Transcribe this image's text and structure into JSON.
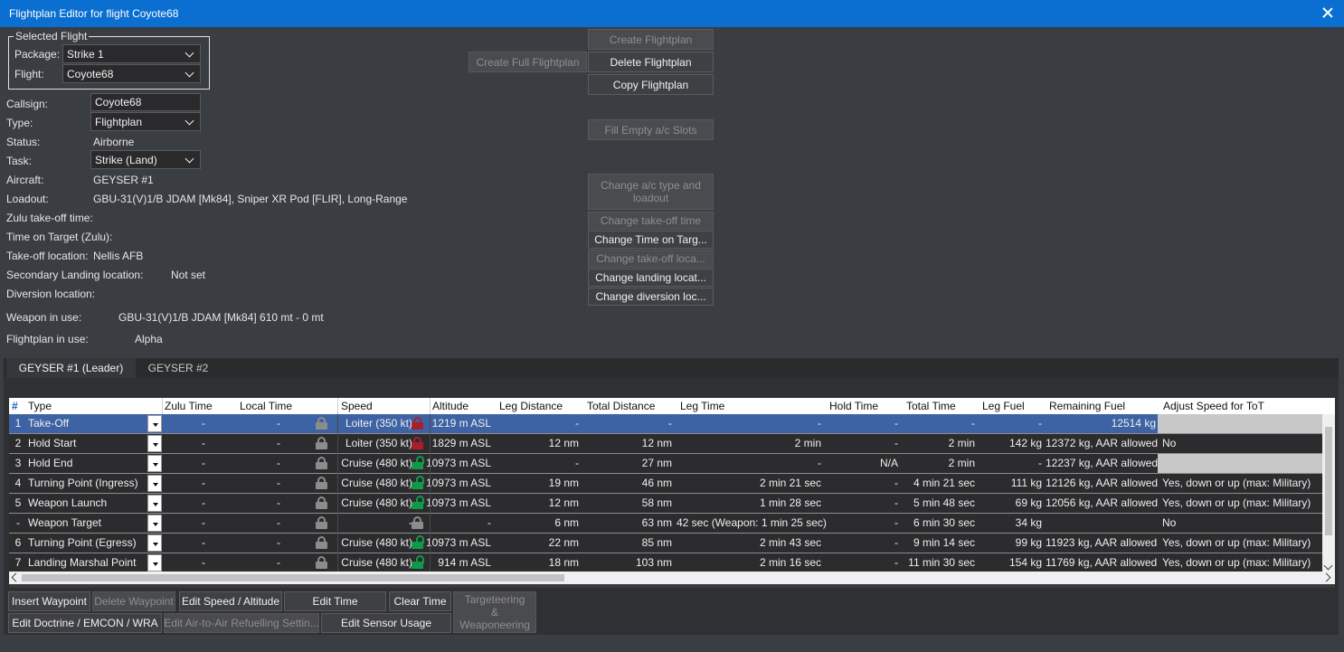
{
  "window": {
    "title": "Flightplan Editor for flight Coyote68"
  },
  "selected_flight": {
    "legend": "Selected Flight",
    "package_label": "Package:",
    "package_value": "Strike 1",
    "flight_label": "Flight:",
    "flight_value": "Coyote68"
  },
  "details": {
    "callsign_label": "Callsign:",
    "callsign_value": "Coyote68",
    "type_label": "Type:",
    "type_value": "Flightplan",
    "status_label": "Status:",
    "status_value": "Airborne",
    "task_label": "Task:",
    "task_value": "Strike (Land)",
    "aircraft_label": "Aircraft:",
    "aircraft_value": "GEYSER #1",
    "loadout_label": "Loadout:",
    "loadout_value": "GBU-31(V)1/B JDAM [Mk84], Sniper XR Pod [FLIR], Long-Range",
    "zulu_takeoff_label": "Zulu take-off time:",
    "tot_label": "Time on Target (Zulu):",
    "takeoff_loc_label": "Take-off location:",
    "takeoff_loc_value": "Nellis AFB",
    "secondary_landing_label": "Secondary Landing location:",
    "secondary_landing_value": "Not set",
    "diversion_label": "Diversion location:",
    "weapon_label": "Weapon in use:",
    "weapon_value": "GBU-31(V)1/B JDAM [Mk84] 610 mt - 0 mt",
    "flightplan_label": "Flightplan in use:",
    "flightplan_value": "Alpha"
  },
  "buttons": {
    "create_flightplan": "Create Flightplan",
    "create_full_flightplan": "Create Full Flightplan",
    "delete_flightplan": "Delete Flightplan",
    "copy_flightplan": "Copy Flightplan",
    "fill_empty": "Fill Empty a/c Slots",
    "change_ac_type": "Change a/c type and loadout",
    "change_takeoff_time": "Change take-off time",
    "change_tot": "Change Time on Targ...",
    "change_takeoff_loc": "Change take-off loca...",
    "change_landing_loc": "Change landing locat...",
    "change_diversion_loc": "Change diversion loc..."
  },
  "tabs": [
    {
      "label": "GEYSER #1 (Leader)"
    },
    {
      "label": "GEYSER #2"
    }
  ],
  "grid": {
    "headers": {
      "num": "#",
      "type": "Type",
      "zulu": "Zulu Time",
      "local": "Local Time",
      "speed": "Speed",
      "altitude": "Altitude",
      "leg_distance": "Leg Distance",
      "total_distance": "Total Distance",
      "leg_time": "Leg Time",
      "hold_time": "Hold Time",
      "total_time": "Total Time",
      "leg_fuel": "Leg Fuel",
      "remaining_fuel": "Remaining Fuel",
      "adjust_speed": "Adjust Speed for ToT"
    },
    "rows": [
      {
        "num": "1",
        "type": "Take-Off",
        "zulu": "-",
        "local": "-",
        "speed": "Loiter (350 kt)",
        "speed_lock": "red",
        "altitude": "1219 m ASL",
        "leg_distance": "-",
        "total_distance": "-",
        "leg_time": "-",
        "hold_time": "-",
        "total_time": "-",
        "leg_fuel": "-",
        "remaining_fuel": "12514 kg",
        "adjust": ""
      },
      {
        "num": "2",
        "type": "Hold Start",
        "zulu": "-",
        "local": "-",
        "speed": "Loiter (350 kt)",
        "speed_lock": "red",
        "altitude": "1829 m ASL",
        "leg_distance": "12 nm",
        "total_distance": "12 nm",
        "leg_time": "2 min",
        "hold_time": "-",
        "total_time": "2 min",
        "leg_fuel": "142 kg",
        "remaining_fuel": "12372 kg, AAR allowed",
        "adjust": "No"
      },
      {
        "num": "3",
        "type": "Hold End",
        "zulu": "-",
        "local": "-",
        "speed": "Cruise (480 kt)",
        "speed_lock": "green",
        "altitude": "10973 m ASL",
        "leg_distance": "-",
        "total_distance": "27 nm",
        "leg_time": "-",
        "hold_time": "N/A",
        "total_time": "2 min",
        "leg_fuel": "-",
        "remaining_fuel": "12237 kg, AAR allowed",
        "adjust": ""
      },
      {
        "num": "4",
        "type": "Turning Point (Ingress)",
        "zulu": "-",
        "local": "-",
        "speed": "Cruise (480 kt)",
        "speed_lock": "green",
        "altitude": "10973 m ASL",
        "leg_distance": "19 nm",
        "total_distance": "46 nm",
        "leg_time": "2 min 21 sec",
        "hold_time": "-",
        "total_time": "4 min 21 sec",
        "leg_fuel": "111 kg",
        "remaining_fuel": "12126 kg, AAR allowed",
        "adjust": "Yes, down or up (max: Military)"
      },
      {
        "num": "5",
        "type": "Weapon Launch",
        "zulu": "-",
        "local": "-",
        "speed": "Cruise (480 kt)",
        "speed_lock": "green",
        "altitude": "10973 m ASL",
        "leg_distance": "12 nm",
        "total_distance": "58 nm",
        "leg_time": "1 min 28 sec",
        "hold_time": "-",
        "total_time": "5 min 48 sec",
        "leg_fuel": "69 kg",
        "remaining_fuel": "12056 kg, AAR allowed",
        "adjust": "Yes, down or up (max: Military)"
      },
      {
        "num": "-",
        "type": "Weapon Target",
        "zulu": "-",
        "local": "-",
        "speed": "-",
        "speed_lock": "gray",
        "altitude": "-",
        "leg_distance": "6 nm",
        "total_distance": "63 nm",
        "leg_time": "42 sec (Weapon: 1 min 25 sec)",
        "hold_time": "-",
        "total_time": "6 min 30 sec",
        "leg_fuel": "34 kg",
        "remaining_fuel": "",
        "adjust": "No"
      },
      {
        "num": "6",
        "type": "Turning Point (Egress)",
        "zulu": "-",
        "local": "-",
        "speed": "Cruise (480 kt)",
        "speed_lock": "green",
        "altitude": "10973 m ASL",
        "leg_distance": "22 nm",
        "total_distance": "85 nm",
        "leg_time": "2 min 43 sec",
        "hold_time": "-",
        "total_time": "9 min 14 sec",
        "leg_fuel": "99 kg",
        "remaining_fuel": "11923 kg, AAR allowed",
        "adjust": "Yes, down or up (max: Military)"
      },
      {
        "num": "7",
        "type": "Landing Marshal Point",
        "zulu": "-",
        "local": "-",
        "speed": "Cruise (480 kt)",
        "speed_lock": "green",
        "altitude": "914 m ASL",
        "leg_distance": "18 nm",
        "total_distance": "103 nm",
        "leg_time": "2 min 16 sec",
        "hold_time": "-",
        "total_time": "11 min 30 sec",
        "leg_fuel": "154 kg",
        "remaining_fuel": "11769 kg, AAR allowed",
        "adjust": "Yes, down or up (max: Military)"
      }
    ]
  },
  "bottom_buttons": {
    "insert_waypoint": "Insert Waypoint",
    "delete_waypoint": "Delete Waypoint",
    "edit_speed_alt": "Edit Speed / Altitude",
    "edit_time": "Edit Time",
    "clear_time": "Clear Time",
    "targeteering": "Targeteering & Weaponeering",
    "edit_doctrine": "Edit Doctrine / EMCON / WRA",
    "edit_aar": "Edit Air-to-Air Refuelling Settin...",
    "edit_sensor": "Edit Sensor Usage"
  },
  "colors": {
    "titlebar": "#0a6fd0",
    "selected_row": "#3e63a4",
    "lock_red": "#a8202c",
    "lock_green": "#0f9a4a"
  }
}
